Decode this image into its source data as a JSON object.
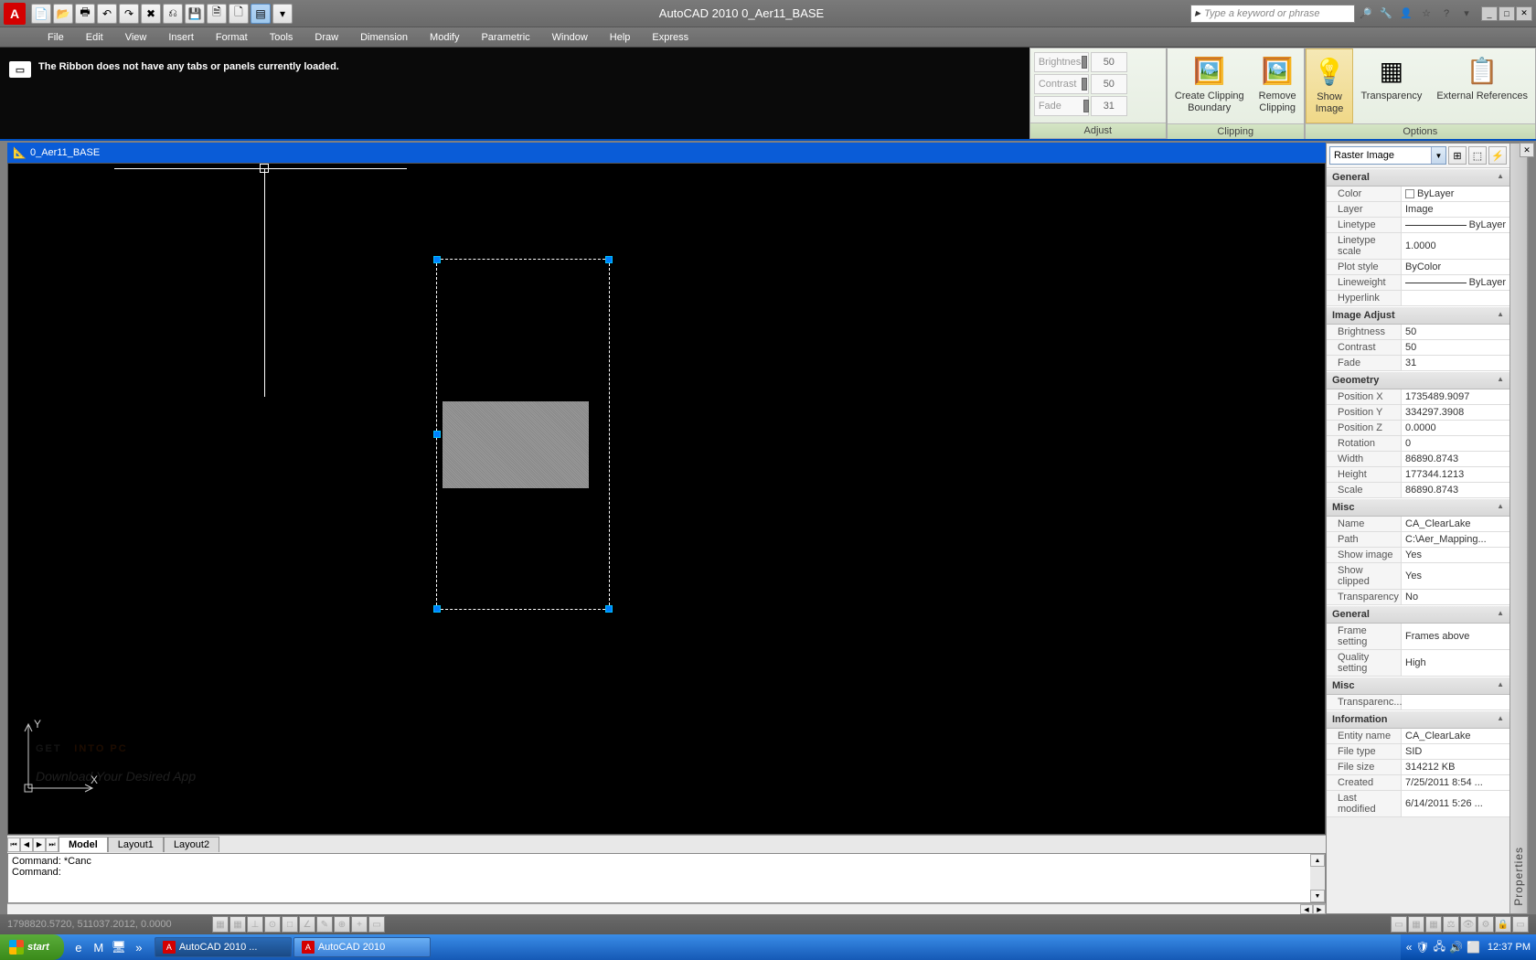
{
  "title": "AutoCAD 2010   0_Aer11_BASE",
  "search_placeholder": "Type a keyword or phrase",
  "menu": [
    "File",
    "Edit",
    "View",
    "Insert",
    "Format",
    "Tools",
    "Draw",
    "Dimension",
    "Modify",
    "Parametric",
    "Window",
    "Help",
    "Express"
  ],
  "ribbon_msg": "The Ribbon does not have any tabs or panels currently loaded.",
  "ribbon": {
    "adjust": {
      "title": "Adjust",
      "rows": [
        {
          "label": "Brightness",
          "val": "50"
        },
        {
          "label": "Contrast",
          "val": "50"
        },
        {
          "label": "Fade",
          "val": "31"
        }
      ]
    },
    "clipping": {
      "title": "Clipping",
      "btns": [
        {
          "label": "Create Clipping\nBoundary",
          "icon": "🖼️"
        },
        {
          "label": "Remove\nClipping",
          "icon": "🖼️"
        }
      ]
    },
    "options": {
      "title": "Options",
      "btns": [
        {
          "label": "Show\nImage",
          "icon": "💡",
          "active": true
        },
        {
          "label": "Transparency",
          "icon": "▦"
        },
        {
          "label": "External References",
          "icon": "📋"
        }
      ]
    }
  },
  "doc_title": "0_Aer11_BASE",
  "tabs": [
    "Model",
    "Layout1",
    "Layout2"
  ],
  "cmd_lines": [
    "Command: *Cancel*",
    "Command:"
  ],
  "cmd1": "Command: *Canc",
  "cmd2": "Command:",
  "coords": "1798820.5720, 511037.2012, 0.0000",
  "watermark1": "GET",
  "watermark2": "INTO PC",
  "watermark_sub": "Download Your Desired App",
  "props": {
    "combo": "Raster Image",
    "strip": "Properties",
    "cats": [
      {
        "name": "General",
        "rows": [
          {
            "n": "Color",
            "v": "ByLayer",
            "sw": true
          },
          {
            "n": "Layer",
            "v": "Image"
          },
          {
            "n": "Linetype",
            "v": "ByLayer",
            "lt": true
          },
          {
            "n": "Linetype scale",
            "v": "1.0000"
          },
          {
            "n": "Plot style",
            "v": "ByColor"
          },
          {
            "n": "Lineweight",
            "v": "ByLayer",
            "lw": true
          },
          {
            "n": "Hyperlink",
            "v": ""
          }
        ]
      },
      {
        "name": "Image Adjust",
        "rows": [
          {
            "n": "Brightness",
            "v": "50"
          },
          {
            "n": "Contrast",
            "v": "50"
          },
          {
            "n": "Fade",
            "v": "31"
          }
        ]
      },
      {
        "name": "Geometry",
        "rows": [
          {
            "n": "Position X",
            "v": "1735489.9097"
          },
          {
            "n": "Position Y",
            "v": "334297.3908"
          },
          {
            "n": "Position Z",
            "v": "0.0000"
          },
          {
            "n": "Rotation",
            "v": "0"
          },
          {
            "n": "Width",
            "v": "86890.8743"
          },
          {
            "n": "Height",
            "v": "177344.1213"
          },
          {
            "n": "Scale",
            "v": "86890.8743"
          }
        ]
      },
      {
        "name": "Misc",
        "rows": [
          {
            "n": "Name",
            "v": "CA_ClearLake"
          },
          {
            "n": "Path",
            "v": "C:\\Aer_Mapping..."
          },
          {
            "n": "Show image",
            "v": "Yes"
          },
          {
            "n": "Show clipped",
            "v": "Yes"
          },
          {
            "n": "Transparency",
            "v": "No"
          }
        ]
      },
      {
        "name": "General",
        "rows": [
          {
            "n": "Frame setting",
            "v": "Frames above"
          },
          {
            "n": "Quality setting",
            "v": "High"
          }
        ]
      },
      {
        "name": "Misc",
        "rows": [
          {
            "n": "Transparenc...",
            "v": ""
          }
        ]
      },
      {
        "name": "Information",
        "rows": [
          {
            "n": "Entity name",
            "v": "CA_ClearLake"
          },
          {
            "n": "File type",
            "v": "SID"
          },
          {
            "n": "File size",
            "v": "314212 KB"
          },
          {
            "n": "Created",
            "v": "7/25/2011 8:54 ..."
          },
          {
            "n": "Last modified",
            "v": "6/14/2011 5:26 ..."
          }
        ]
      }
    ]
  },
  "taskbar": {
    "start": "start",
    "tasks": [
      {
        "label": "AutoCAD 2010 ...",
        "active": true
      },
      {
        "label": "AutoCAD 2010",
        "active": false
      }
    ],
    "clock": "12:37 PM"
  }
}
